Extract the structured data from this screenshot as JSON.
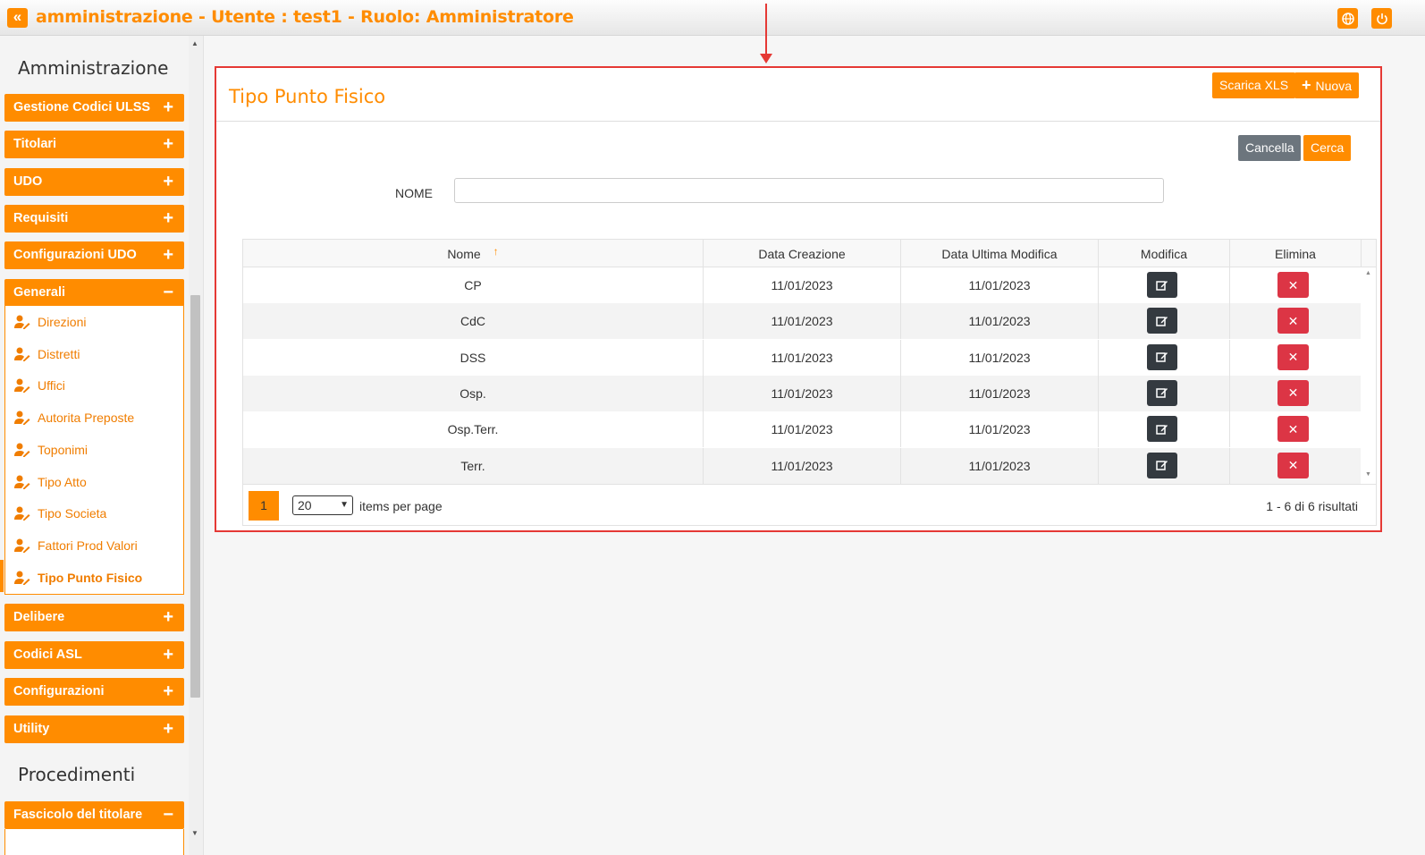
{
  "topbar": {
    "title": "amministrazione - Utente : test1 - Ruolo: Amministratore",
    "back_icon": "double-chevron-left-icon",
    "globe_icon": "globe-icon",
    "power_icon": "power-icon"
  },
  "sidebar": {
    "section1": "Amministrazione",
    "groups_top": [
      {
        "label": "Gestione Codici ULSS",
        "toggle": "+"
      },
      {
        "label": "Titolari",
        "toggle": "+"
      },
      {
        "label": "UDO",
        "toggle": "+"
      },
      {
        "label": "Requisiti",
        "toggle": "+"
      },
      {
        "label": "Configurazioni UDO",
        "toggle": "+"
      },
      {
        "label": "Generali",
        "toggle": "−"
      }
    ],
    "generali_items": [
      {
        "label": "Direzioni"
      },
      {
        "label": "Distretti"
      },
      {
        "label": "Uffici"
      },
      {
        "label": "Autorita Preposte"
      },
      {
        "label": "Toponimi"
      },
      {
        "label": "Tipo Atto"
      },
      {
        "label": "Tipo Societa"
      },
      {
        "label": "Fattori Prod Valori"
      },
      {
        "label": "Tipo Punto Fisico"
      }
    ],
    "groups_bottom": [
      {
        "label": "Delibere",
        "toggle": "+"
      },
      {
        "label": "Codici ASL",
        "toggle": "+"
      },
      {
        "label": "Configurazioni",
        "toggle": "+"
      },
      {
        "label": "Utility",
        "toggle": "+"
      }
    ],
    "section2": "Procedimenti",
    "groups_proc": [
      {
        "label": "Fascicolo del titolare",
        "toggle": "−"
      }
    ]
  },
  "card": {
    "title": "Tipo Punto Fisico",
    "download_label": "Scarica XLS",
    "new_label": "Nuova",
    "cancel_label": "Cancella",
    "search_label": "Cerca",
    "name_label": "NOME",
    "name_value": ""
  },
  "table": {
    "columns": [
      "Nome",
      "Data Creazione",
      "Data Ultima Modifica",
      "Modifica",
      "Elimina"
    ],
    "sort_indicator": "↑",
    "rows": [
      {
        "nome": "CP",
        "creazione": "11/01/2023",
        "modifica": "11/01/2023"
      },
      {
        "nome": "CdC",
        "creazione": "11/01/2023",
        "modifica": "11/01/2023"
      },
      {
        "nome": "DSS",
        "creazione": "11/01/2023",
        "modifica": "11/01/2023"
      },
      {
        "nome": "Osp.",
        "creazione": "11/01/2023",
        "modifica": "11/01/2023"
      },
      {
        "nome": "Osp.Terr.",
        "creazione": "11/01/2023",
        "modifica": "11/01/2023"
      },
      {
        "nome": "Terr.",
        "creazione": "11/01/2023",
        "modifica": "11/01/2023"
      }
    ],
    "edit_icon": "edit-icon",
    "delete_icon": "close-icon",
    "delete_glyph": "✕"
  },
  "pager": {
    "current_page": "1",
    "page_size": "20",
    "items_per_page_label": "items per page",
    "results_label": "1 - 6 di 6 risultati"
  },
  "colors": {
    "accent": "#ff8c00",
    "danger": "#dc3545",
    "dark": "#343a40",
    "annotation": "#e53935"
  }
}
